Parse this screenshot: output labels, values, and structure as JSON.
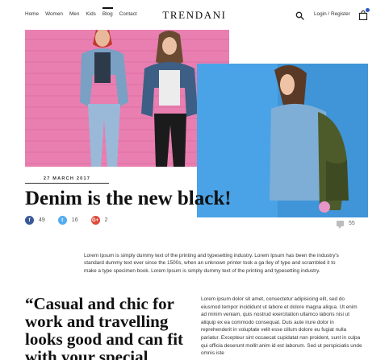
{
  "header": {
    "nav": [
      "Home",
      "Women",
      "Men",
      "Kids",
      "Blog",
      "Contact"
    ],
    "active_nav": "Blog",
    "logo": "TRENDANI",
    "login": "Login / Register",
    "icons": {
      "search": "search-icon",
      "bag": "shopping-bag-icon"
    },
    "accent_color": "#2b58c6"
  },
  "article": {
    "date": "27 MARCH 2017",
    "title": "Denim is the new black!",
    "shares": {
      "facebook": "49",
      "twitter": "16",
      "google_plus": "2"
    },
    "comments": "55",
    "intro": "Lorem Ipsum is simply dummy text of the printing and typesetting industry. Lorem Ipsum has been the industry's standard dummy text ever since the 1500s, when an unknown printer took a ga lley of type and scrambled it to make a type specimen book. Lorem Ipsum is simply dummy text of the printing and typesetting industry.",
    "quote": "“Casual and chic for work and travelling looks good and can fit with your special",
    "body": "Lorem ipsum dolor sit amet, consectetur adipisicing elit, sed do eiusmod tempor incididunt ut labore et dolore magna aliqua. Ut enim ad minim veniam, quis nostrud exercitation ullamco laboris nisi ut aliquip ex ea commodo consequat. Duis aute irure dolor in reprehenderit in voluptate velit esse cillum dolore eu fugiat nulla pariatur. Excepteur sint occaecat cupidatat non proident, sunt in culpa qui officia deserunt mollit anim id est laborum. Sed ut perspiciatis unde omnis iste"
  },
  "colors": {
    "pink_wall": "#e97fb1",
    "blue_wall": "#4aa3e6",
    "facebook": "#3b5998",
    "twitter": "#55acee",
    "google_plus": "#dd4b39"
  }
}
